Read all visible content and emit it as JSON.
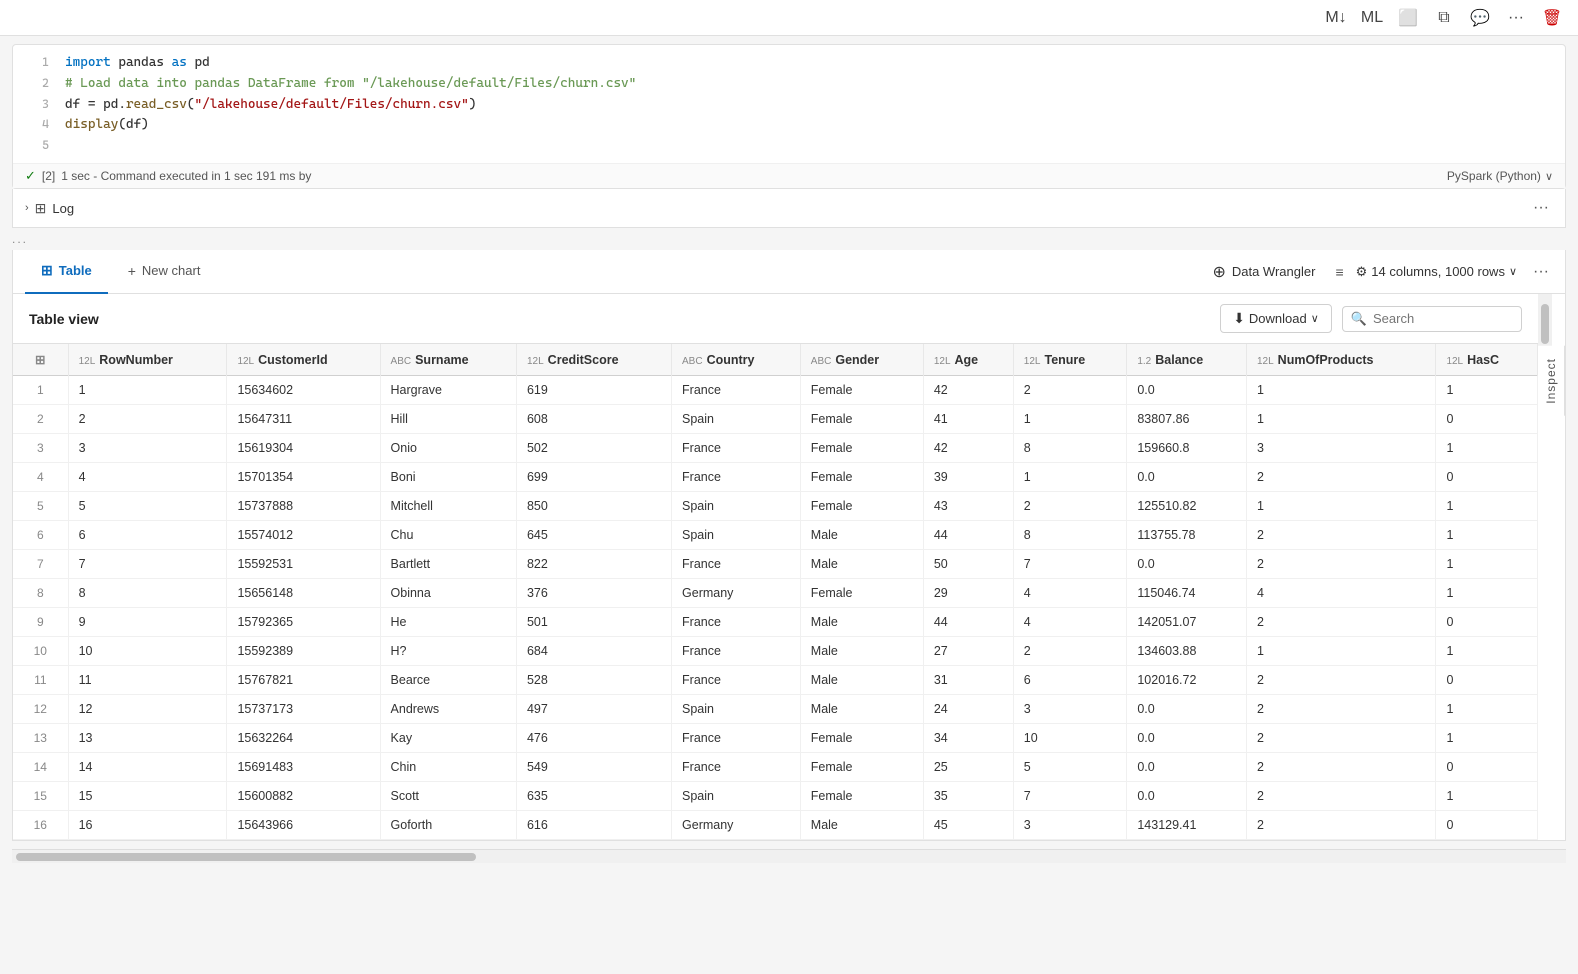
{
  "toolbar": {
    "buttons": [
      "markdown-icon",
      "ml-icon",
      "monitor-icon",
      "copy-icon",
      "chat-icon",
      "more-icon",
      "delete-icon"
    ]
  },
  "code_cell": {
    "cell_number": "[2]",
    "lines": [
      {
        "num": 1,
        "text": "import pandas as pd"
      },
      {
        "num": 2,
        "text": "# Load data into pandas DataFrame from \"/lakehouse/default/Files/churn.csv\""
      },
      {
        "num": 3,
        "text": "df = pd.read_csv(\"/lakehouse/default/Files/churn.csv\")"
      },
      {
        "num": 4,
        "text": "display(df)"
      },
      {
        "num": 5,
        "text": ""
      }
    ],
    "status": "✓",
    "execution_time": "1 sec - Command executed in 1 sec 191 ms by",
    "runtime": "PySpark (Python)",
    "runtime_chevron": "∨"
  },
  "log": {
    "label": "Log",
    "chevron": "›"
  },
  "ellipsis": "...",
  "tabs": {
    "items": [
      {
        "id": "table",
        "label": "Table",
        "icon": "grid",
        "active": true
      },
      {
        "id": "new-chart",
        "label": "New chart",
        "icon": "plus",
        "active": false
      }
    ],
    "data_wrangler_label": "Data Wrangler",
    "filter_icon": "≡",
    "columns_info": "14 columns, 1000 rows",
    "gear_icon": "⚙",
    "more_icon": "···"
  },
  "table_view": {
    "title": "Table view",
    "download_label": "Download",
    "search_placeholder": "Search",
    "inspect_label": "Inspect"
  },
  "table": {
    "columns": [
      {
        "id": "grid",
        "label": "",
        "type": ""
      },
      {
        "id": "rownumber",
        "label": "RowNumber",
        "type": "12L"
      },
      {
        "id": "customerid",
        "label": "CustomerId",
        "type": "12L"
      },
      {
        "id": "surname",
        "label": "Surname",
        "type": "ABC"
      },
      {
        "id": "creditscore",
        "label": "CreditScore",
        "type": "12L"
      },
      {
        "id": "country",
        "label": "Country",
        "type": "ABC"
      },
      {
        "id": "gender",
        "label": "Gender",
        "type": "ABC"
      },
      {
        "id": "age",
        "label": "Age",
        "type": "12L"
      },
      {
        "id": "tenure",
        "label": "Tenure",
        "type": "12L"
      },
      {
        "id": "balance",
        "label": "Balance",
        "type": "1.2"
      },
      {
        "id": "numofproducts",
        "label": "NumOfProducts",
        "type": "12L"
      },
      {
        "id": "hasc",
        "label": "HasC",
        "type": "12L"
      }
    ],
    "rows": [
      {
        "idx": 1,
        "RowNumber": 1,
        "CustomerId": 15634602,
        "Surname": "Hargrave",
        "CreditScore": 619,
        "Country": "France",
        "Gender": "Female",
        "Age": 42,
        "Tenure": 2,
        "Balance": "0.0",
        "NumOfProducts": 1,
        "HasC": 1
      },
      {
        "idx": 2,
        "RowNumber": 2,
        "CustomerId": 15647311,
        "Surname": "Hill",
        "CreditScore": 608,
        "Country": "Spain",
        "Gender": "Female",
        "Age": 41,
        "Tenure": 1,
        "Balance": "83807.86",
        "NumOfProducts": 1,
        "HasC": 0
      },
      {
        "idx": 3,
        "RowNumber": 3,
        "CustomerId": 15619304,
        "Surname": "Onio",
        "CreditScore": 502,
        "Country": "France",
        "Gender": "Female",
        "Age": 42,
        "Tenure": 8,
        "Balance": "159660.8",
        "NumOfProducts": 3,
        "HasC": 1
      },
      {
        "idx": 4,
        "RowNumber": 4,
        "CustomerId": 15701354,
        "Surname": "Boni",
        "CreditScore": 699,
        "Country": "France",
        "Gender": "Female",
        "Age": 39,
        "Tenure": 1,
        "Balance": "0.0",
        "NumOfProducts": 2,
        "HasC": 0
      },
      {
        "idx": 5,
        "RowNumber": 5,
        "CustomerId": 15737888,
        "Surname": "Mitchell",
        "CreditScore": 850,
        "Country": "Spain",
        "Gender": "Female",
        "Age": 43,
        "Tenure": 2,
        "Balance": "125510.82",
        "NumOfProducts": 1,
        "HasC": 1
      },
      {
        "idx": 6,
        "RowNumber": 6,
        "CustomerId": 15574012,
        "Surname": "Chu",
        "CreditScore": 645,
        "Country": "Spain",
        "Gender": "Male",
        "Age": 44,
        "Tenure": 8,
        "Balance": "113755.78",
        "NumOfProducts": 2,
        "HasC": 1
      },
      {
        "idx": 7,
        "RowNumber": 7,
        "CustomerId": 15592531,
        "Surname": "Bartlett",
        "CreditScore": 822,
        "Country": "France",
        "Gender": "Male",
        "Age": 50,
        "Tenure": 7,
        "Balance": "0.0",
        "NumOfProducts": 2,
        "HasC": 1
      },
      {
        "idx": 8,
        "RowNumber": 8,
        "CustomerId": 15656148,
        "Surname": "Obinna",
        "CreditScore": 376,
        "Country": "Germany",
        "Gender": "Female",
        "Age": 29,
        "Tenure": 4,
        "Balance": "115046.74",
        "NumOfProducts": 4,
        "HasC": 1
      },
      {
        "idx": 9,
        "RowNumber": 9,
        "CustomerId": 15792365,
        "Surname": "He",
        "CreditScore": 501,
        "Country": "France",
        "Gender": "Male",
        "Age": 44,
        "Tenure": 4,
        "Balance": "142051.07",
        "NumOfProducts": 2,
        "HasC": 0
      },
      {
        "idx": 10,
        "RowNumber": 10,
        "CustomerId": 15592389,
        "Surname": "H?",
        "CreditScore": 684,
        "Country": "France",
        "Gender": "Male",
        "Age": 27,
        "Tenure": 2,
        "Balance": "134603.88",
        "NumOfProducts": 1,
        "HasC": 1
      },
      {
        "idx": 11,
        "RowNumber": 11,
        "CustomerId": 15767821,
        "Surname": "Bearce",
        "CreditScore": 528,
        "Country": "France",
        "Gender": "Male",
        "Age": 31,
        "Tenure": 6,
        "Balance": "102016.72",
        "NumOfProducts": 2,
        "HasC": 0
      },
      {
        "idx": 12,
        "RowNumber": 12,
        "CustomerId": 15737173,
        "Surname": "Andrews",
        "CreditScore": 497,
        "Country": "Spain",
        "Gender": "Male",
        "Age": 24,
        "Tenure": 3,
        "Balance": "0.0",
        "NumOfProducts": 2,
        "HasC": 1
      },
      {
        "idx": 13,
        "RowNumber": 13,
        "CustomerId": 15632264,
        "Surname": "Kay",
        "CreditScore": 476,
        "Country": "France",
        "Gender": "Female",
        "Age": 34,
        "Tenure": 10,
        "Balance": "0.0",
        "NumOfProducts": 2,
        "HasC": 1
      },
      {
        "idx": 14,
        "RowNumber": 14,
        "CustomerId": 15691483,
        "Surname": "Chin",
        "CreditScore": 549,
        "Country": "France",
        "Gender": "Female",
        "Age": 25,
        "Tenure": 5,
        "Balance": "0.0",
        "NumOfProducts": 2,
        "HasC": 0
      },
      {
        "idx": 15,
        "RowNumber": 15,
        "CustomerId": 15600882,
        "Surname": "Scott",
        "CreditScore": 635,
        "Country": "Spain",
        "Gender": "Female",
        "Age": 35,
        "Tenure": 7,
        "Balance": "0.0",
        "NumOfProducts": 2,
        "HasC": 1
      },
      {
        "idx": 16,
        "RowNumber": 16,
        "CustomerId": 15643966,
        "Surname": "Goforth",
        "CreditScore": 616,
        "Country": "Germany",
        "Gender": "Male",
        "Age": 45,
        "Tenure": 3,
        "Balance": "143129.41",
        "NumOfProducts": 2,
        "HasC": 0
      }
    ]
  }
}
